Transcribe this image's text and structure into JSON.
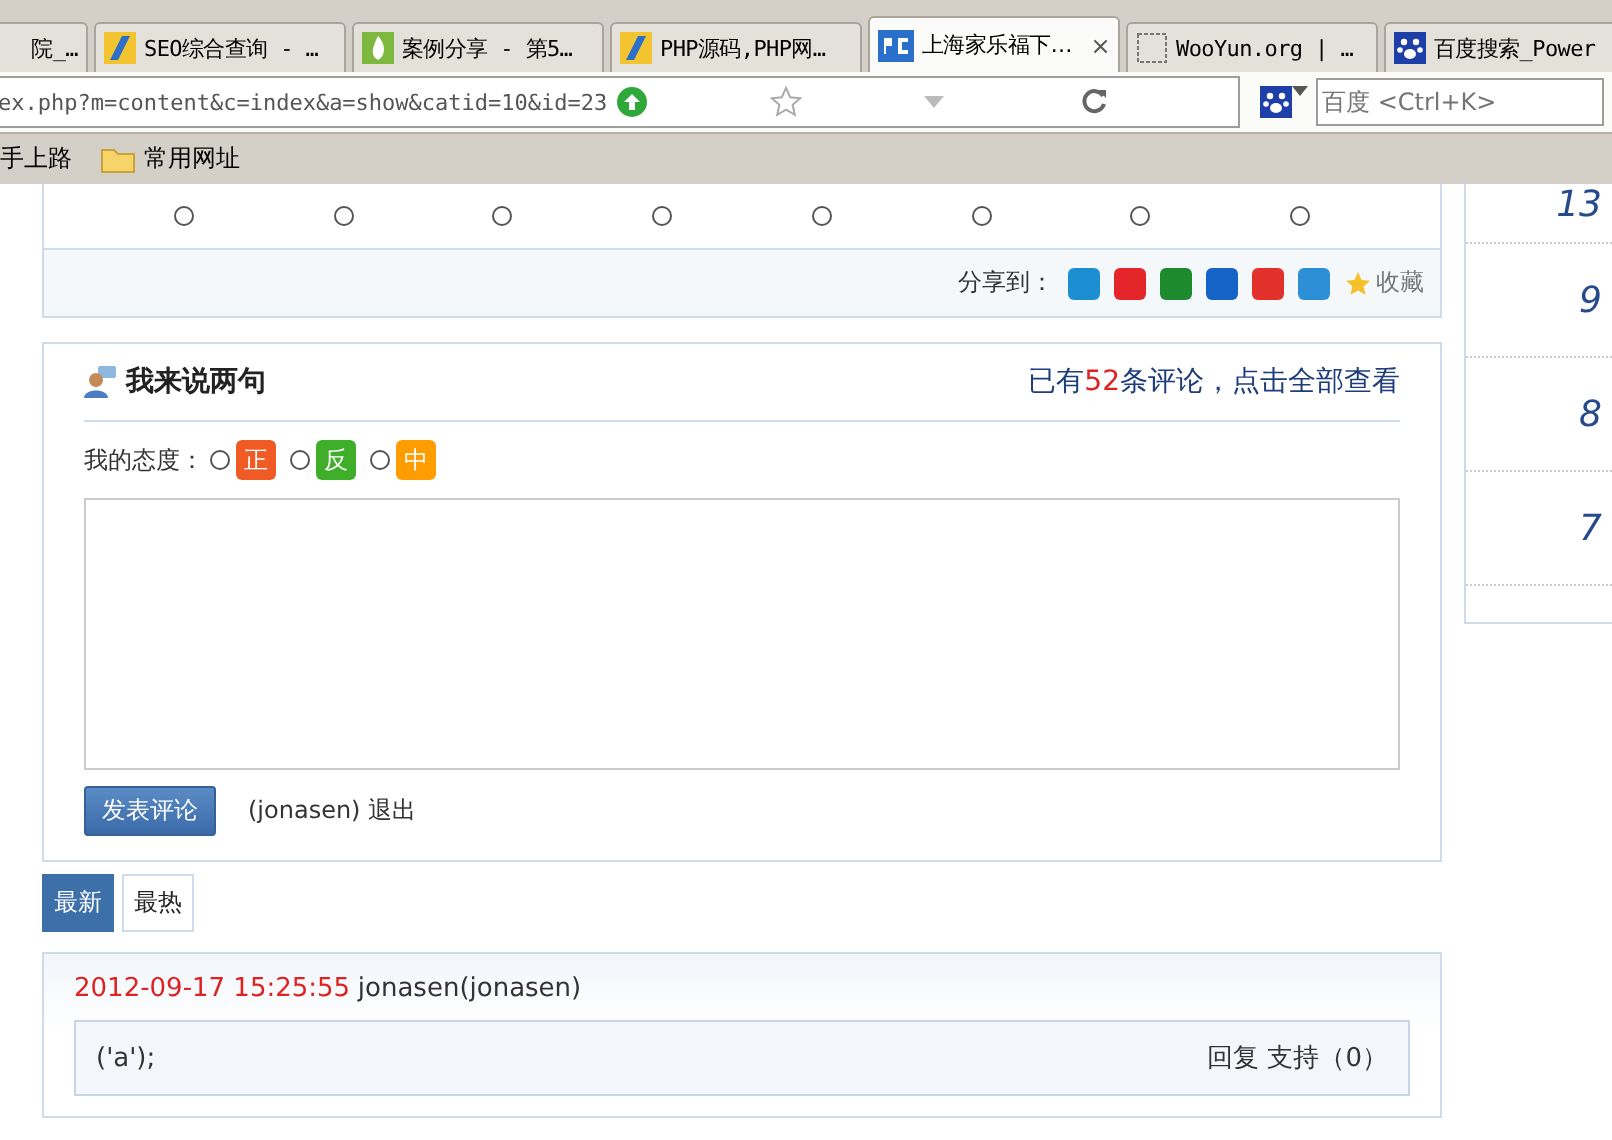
{
  "browser": {
    "tabs": [
      {
        "title": "院_…",
        "selected": false,
        "kind": "none"
      },
      {
        "title": "SEO综合查询 - …",
        "selected": false,
        "kind": "stripes"
      },
      {
        "title": "案例分享 - 第5…",
        "selected": false,
        "kind": "flame"
      },
      {
        "title": "PHP源码,PHP网…",
        "selected": false,
        "kind": "stripes"
      },
      {
        "title": "上海家乐福下…",
        "selected": true,
        "kind": "pc",
        "close": "×"
      },
      {
        "title": "WooYun.org | …",
        "selected": false,
        "kind": "blank"
      },
      {
        "title": "百度搜索_Power",
        "selected": false,
        "kind": "paw"
      }
    ],
    "address": "ex.php?m=content&c=index&a=show&catid=10&id=23",
    "search_placeholder": "百度 <Ctrl+K>",
    "bookmarks": [
      {
        "label": "手上路",
        "kind": "plain"
      },
      {
        "label": "常用网址",
        "kind": "folder"
      }
    ]
  },
  "mood": {
    "options": [
      {
        "checked": false
      },
      {
        "checked": false
      },
      {
        "checked": false
      },
      {
        "checked": false
      },
      {
        "checked": false
      },
      {
        "checked": false
      },
      {
        "checked": false
      },
      {
        "checked": false
      }
    ]
  },
  "share": {
    "label": "分享到：",
    "services": [
      {
        "color": "#1b8fd2"
      },
      {
        "color": "#e4262b"
      },
      {
        "color": "#1e8a2e"
      },
      {
        "color": "#1663c7"
      },
      {
        "color": "#e2312a"
      },
      {
        "color": "#2d8fd6"
      }
    ],
    "favorite": "收藏"
  },
  "comment_form": {
    "title": "我来说两句",
    "count_prefix": "已有",
    "count": "52",
    "count_suffix": "条评论，点击全部查看",
    "attitude_label": "我的态度：",
    "attitudes": [
      {
        "label": "正",
        "color": "#f05a24",
        "selected": false
      },
      {
        "label": "反",
        "color": "#3fae29",
        "selected": false
      },
      {
        "label": "中",
        "color": "#ff9c00",
        "selected": false
      }
    ],
    "submit": "发表评论",
    "user": "(jonasen)",
    "logout": "退出"
  },
  "sort_tabs": [
    {
      "label": "最新",
      "selected": true
    },
    {
      "label": "最热",
      "selected": false
    }
  ],
  "comments": [
    {
      "time": "2012-09-17 15:25:55",
      "author": "jonasen(jonasen)",
      "body": "('a');",
      "reply": "回复",
      "support": "支持（0）"
    }
  ],
  "sidebar": {
    "counts": [
      "13",
      "9",
      "8",
      "7"
    ]
  }
}
